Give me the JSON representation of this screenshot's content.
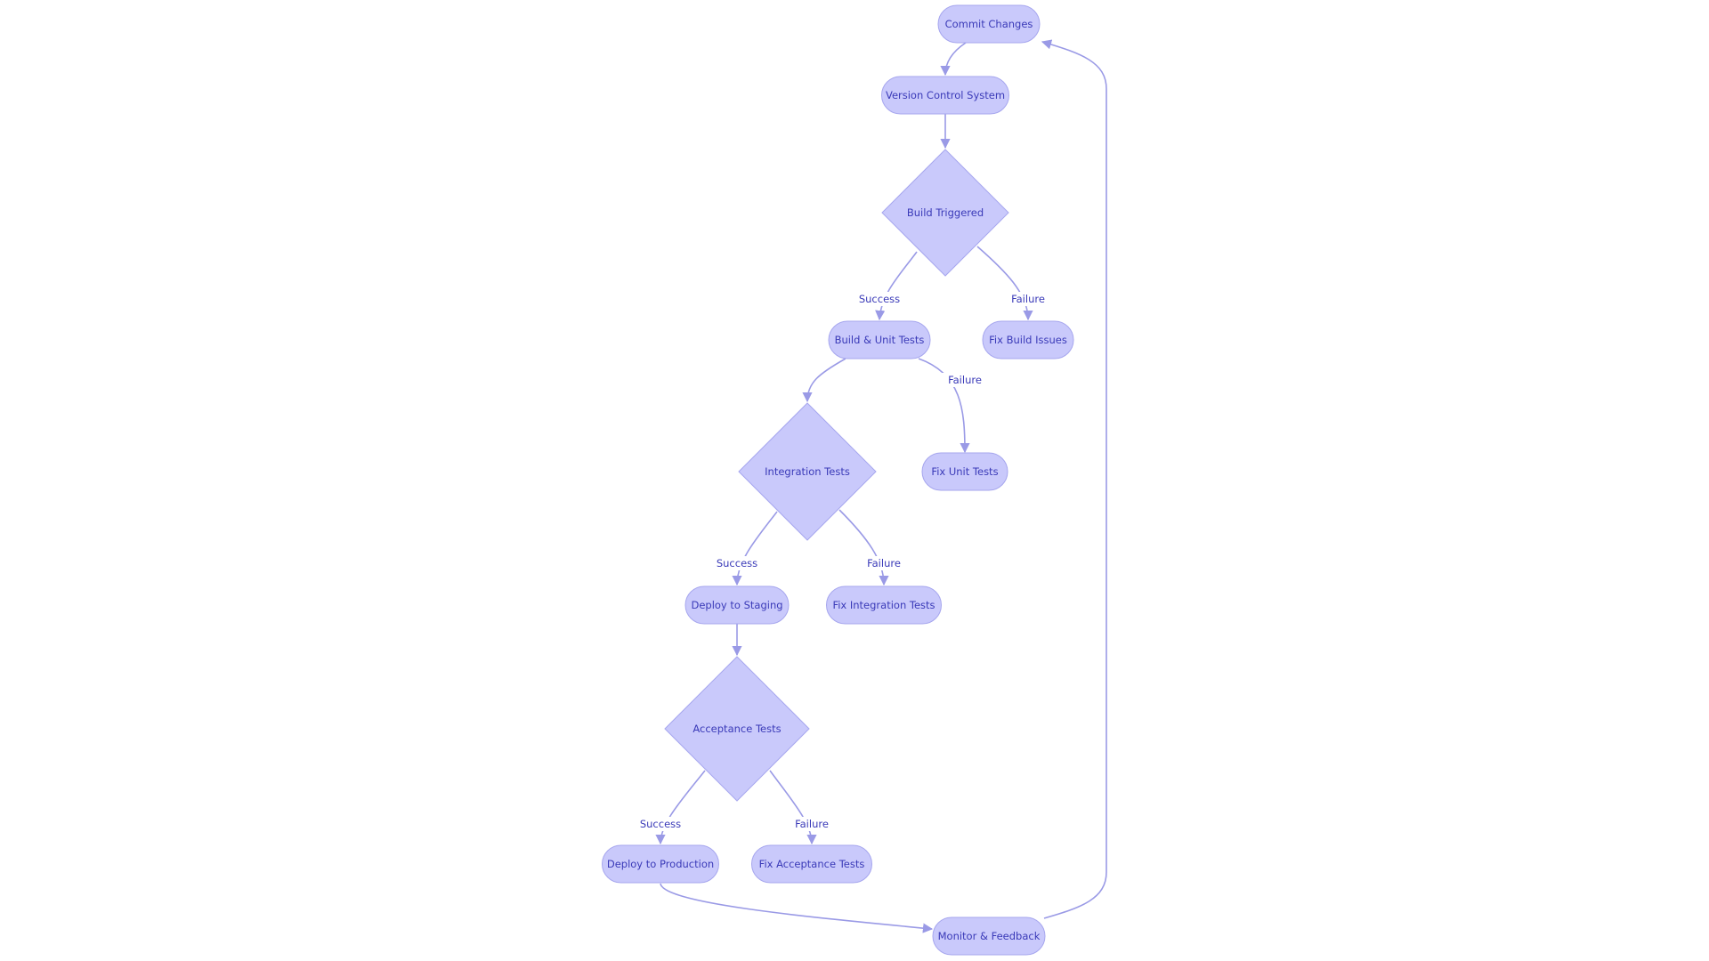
{
  "diagram": {
    "type": "flowchart",
    "colors": {
      "node_fill": "#c9c9fb",
      "node_stroke": "#a6a6ee",
      "edge": "#9a9ae6",
      "text": "#3a3ab8"
    },
    "nodes": {
      "commit": {
        "label": "Commit Changes",
        "shape": "rounded"
      },
      "vcs": {
        "label": "Version Control System",
        "shape": "rounded"
      },
      "build": {
        "label": "Build Triggered",
        "shape": "diamond"
      },
      "unit": {
        "label": "Build & Unit Tests",
        "shape": "rounded"
      },
      "fixbuild": {
        "label": "Fix Build Issues",
        "shape": "rounded"
      },
      "integ": {
        "label": "Integration Tests",
        "shape": "diamond"
      },
      "fixunit": {
        "label": "Fix Unit Tests",
        "shape": "rounded"
      },
      "staging": {
        "label": "Deploy to Staging",
        "shape": "rounded"
      },
      "fixinteg": {
        "label": "Fix Integration Tests",
        "shape": "rounded"
      },
      "accept": {
        "label": "Acceptance Tests",
        "shape": "diamond"
      },
      "prod": {
        "label": "Deploy to Production",
        "shape": "rounded"
      },
      "fixaccept": {
        "label": "Fix Acceptance Tests",
        "shape": "rounded"
      },
      "monitor": {
        "label": "Monitor & Feedback",
        "shape": "rounded"
      }
    },
    "edges": [
      {
        "from": "commit",
        "to": "vcs",
        "label": ""
      },
      {
        "from": "vcs",
        "to": "build",
        "label": ""
      },
      {
        "from": "build",
        "to": "unit",
        "label": "Success"
      },
      {
        "from": "build",
        "to": "fixbuild",
        "label": "Failure"
      },
      {
        "from": "unit",
        "to": "integ",
        "label": ""
      },
      {
        "from": "unit",
        "to": "fixunit",
        "label": "Failure"
      },
      {
        "from": "integ",
        "to": "staging",
        "label": "Success"
      },
      {
        "from": "integ",
        "to": "fixinteg",
        "label": "Failure"
      },
      {
        "from": "staging",
        "to": "accept",
        "label": ""
      },
      {
        "from": "accept",
        "to": "prod",
        "label": "Success"
      },
      {
        "from": "accept",
        "to": "fixaccept",
        "label": "Failure"
      },
      {
        "from": "prod",
        "to": "monitor",
        "label": ""
      },
      {
        "from": "monitor",
        "to": "commit",
        "label": ""
      }
    ]
  }
}
